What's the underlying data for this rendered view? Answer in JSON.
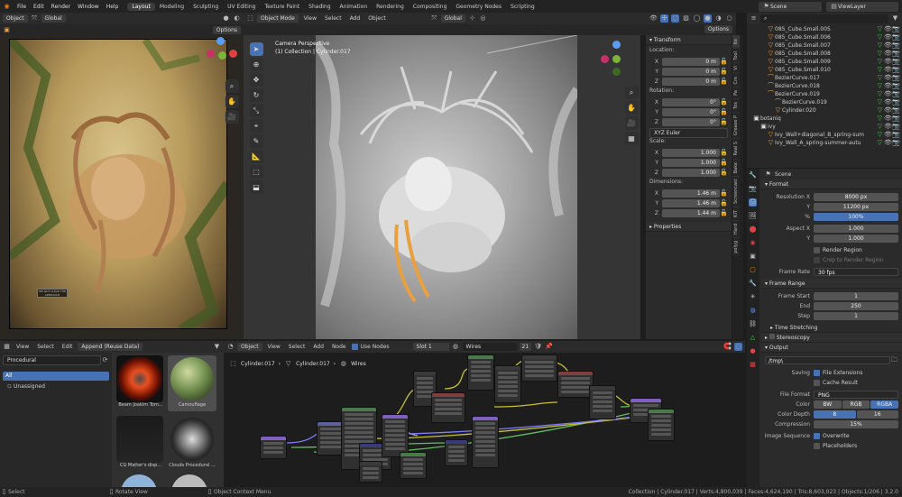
{
  "menu": {
    "items": [
      "File",
      "Edit",
      "Render",
      "Window",
      "Help"
    ],
    "workspaces": [
      "Layout",
      "Modeling",
      "Sculpting",
      "UV Editing",
      "Texture Paint",
      "Shading",
      "Animation",
      "Rendering",
      "Compositing",
      "Geometry Nodes",
      "Scripting"
    ],
    "active": "Layout",
    "scene": "Scene",
    "view_layer": "ViewLayer"
  },
  "left_view": {
    "mode": "Object",
    "orientation": "Global",
    "options": "Options",
    "plaque": "WE NOT CLEAR THE APPROACH"
  },
  "viewport": {
    "mode": "Object Mode",
    "menus": [
      "View",
      "Select",
      "Add",
      "Object"
    ],
    "orientation": "Global",
    "options": "Options",
    "info_line1": "Camera Perspective",
    "info_line2": "(1) Collection | Cylinder.017"
  },
  "transform": {
    "title": "Transform",
    "location_label": "Location:",
    "rotation_label": "Rotation:",
    "scale_label": "Scale:",
    "dimensions_label": "Dimensions:",
    "rotation_mode": "XYZ Euler",
    "properties_label": "Properties",
    "location": [
      {
        "axis": "X",
        "value": "0 m"
      },
      {
        "axis": "Y",
        "value": "0 m"
      },
      {
        "axis": "Z",
        "value": "0 m"
      }
    ],
    "rotation": [
      {
        "axis": "X",
        "value": "0°"
      },
      {
        "axis": "Y",
        "value": "0°"
      },
      {
        "axis": "Z",
        "value": "0°"
      }
    ],
    "scale": [
      {
        "axis": "X",
        "value": "1.000"
      },
      {
        "axis": "Y",
        "value": "1.000"
      },
      {
        "axis": "Z",
        "value": "1.000"
      }
    ],
    "dimensions": [
      {
        "axis": "X",
        "value": "1.46 m"
      },
      {
        "axis": "Y",
        "value": "1.46 m"
      },
      {
        "axis": "Z",
        "value": "1.44 m"
      }
    ]
  },
  "side_tabs": [
    "Ite",
    "Tool",
    "Vi",
    "Cre",
    "Pa",
    "Tos",
    "Grease P",
    "Real S",
    "Bake",
    "Screencast",
    "KIT",
    "Hard",
    "polyg"
  ],
  "outliner": {
    "items": [
      {
        "name": "085_Cube.Small.005",
        "depth": 2
      },
      {
        "name": "085_Cube.Small.006",
        "depth": 2
      },
      {
        "name": "085_Cube.Small.007",
        "depth": 2
      },
      {
        "name": "085_Cube.Small.008",
        "depth": 2
      },
      {
        "name": "085_Cube.Small.009",
        "depth": 2
      },
      {
        "name": "085_Cube.Small.010",
        "depth": 2
      },
      {
        "name": "BezierCurve.017",
        "depth": 2
      },
      {
        "name": "BezierCurve.018",
        "depth": 2
      },
      {
        "name": "BezierCurve.019",
        "depth": 2
      },
      {
        "name": "BezierCurve.019",
        "depth": 3
      },
      {
        "name": "Cylinder.020",
        "depth": 3
      },
      {
        "name": "botaniq",
        "depth": 0
      },
      {
        "name": "ivy",
        "depth": 1
      },
      {
        "name": "Ivy_Wall+diagonal_B_spring-sum",
        "depth": 2
      },
      {
        "name": "Ivy_Wall_A_spring-summer-autu",
        "depth": 2
      }
    ]
  },
  "properties": {
    "scene": "Scene",
    "format_title": "Format",
    "resolution_label": "Resolution X",
    "res_x": "8000 px",
    "y_label": "Y",
    "res_y": "11200 px",
    "pct_label": "%",
    "pct": "100%",
    "aspect_label": "Aspect X",
    "aspect_x": "1.000",
    "aspect_y": "1.000",
    "render_region": "Render Region",
    "crop": "Crop to Render Region",
    "frame_rate_label": "Frame Rate",
    "frame_rate": "30 fps",
    "frame_range_title": "Frame Range",
    "frame_start_label": "Frame Start",
    "frame_start": "1",
    "end_label": "End",
    "frame_end": "250",
    "step_label": "Step",
    "step": "1",
    "time_stretching": "Time Stretching",
    "stereoscopy": "Stereoscopy",
    "output_title": "Output",
    "output_path": "/tmp\\",
    "saving_label": "Saving",
    "file_ext": "File Extensions",
    "cache": "Cache Result",
    "file_format_label": "File Format",
    "file_format": "PNG",
    "color_label": "Color",
    "color_opts": [
      "BW",
      "RGB",
      "RGBA"
    ],
    "color_depth_label": "Color Depth",
    "depths": [
      "8",
      "16"
    ],
    "compression_label": "Compression",
    "compression": "15%",
    "image_seq_label": "Image Sequence",
    "overwrite": "Overwrite",
    "placeholders": "Placeholders"
  },
  "asset_browser": {
    "menus": [
      "View",
      "Select",
      "Edit"
    ],
    "import_mode": "Append (Reuse Data)",
    "library": "Procedural",
    "catalog": "All",
    "unassigned": "Unassigned",
    "assets": [
      "Beam Joakim Tom...",
      "Camouflage",
      "CG Matter's disp...",
      "Clouds Procedural ..."
    ]
  },
  "node_editor": {
    "mode": "Object",
    "menus": [
      "View",
      "Select",
      "Add",
      "Node"
    ],
    "use_nodes": "Use Nodes",
    "slot": "Slot 1",
    "material": "Wires",
    "users": "21",
    "breadcrumb": [
      "Cylinder.017",
      "Cylinder.017",
      "Wires"
    ]
  },
  "status": {
    "left": [
      "Select",
      "Rotate View",
      "Object Context Menu"
    ],
    "right": "Collection | Cylinder.017 | Verts:4,800,039 | Faces:4,624,190 | Tris:8,603,023 | Objects:1/206 | 3.2.0"
  },
  "colors": {
    "accent": "#4772b3",
    "selection": "#e8a040",
    "wire_yellow": "#c8c030",
    "wire_green": "#5fbf5f",
    "wire_purple": "#7f7fff"
  },
  "icons": [
    "blender-logo-icon",
    "cursor-icon",
    "move-icon",
    "rotate-icon",
    "scale-icon",
    "transform-icon",
    "annotate-icon",
    "measure-icon",
    "add-cube-icon",
    "zoom-icon",
    "hand-icon",
    "camera-icon",
    "grid-icon",
    "eye-icon",
    "render-icon",
    "scene-icon",
    "wrench-icon",
    "folder-icon",
    "gear-icon"
  ]
}
